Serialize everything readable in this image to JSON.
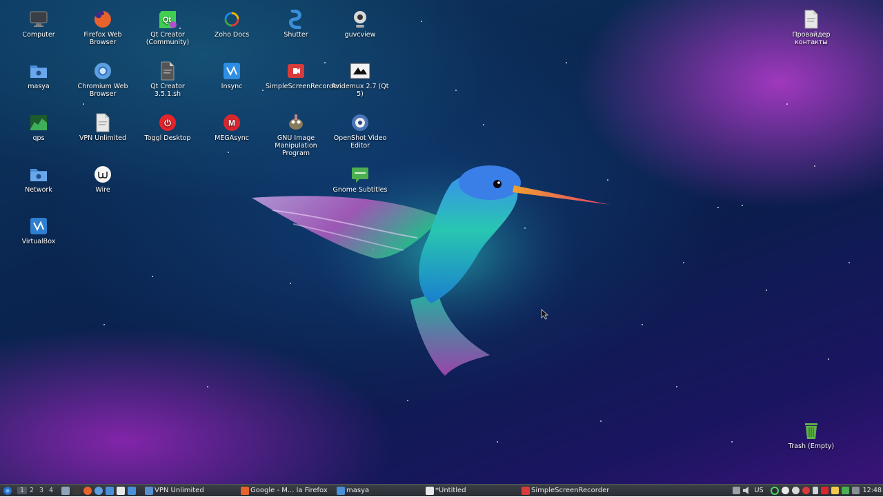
{
  "desktop": {
    "icons": [
      {
        "label": "Computer",
        "icon": "computer-icon",
        "color": "#3a3f46"
      },
      {
        "label": "Firefox Web Browser",
        "icon": "firefox-icon",
        "color": "#e8632b"
      },
      {
        "label": "Qt Creator (Community)",
        "icon": "qt-creator-icon",
        "color": "#41cd52"
      },
      {
        "label": "Zoho Docs",
        "icon": "zoho-docs-icon",
        "color": "#f4b400"
      },
      {
        "label": "Shutter",
        "icon": "shutter-icon",
        "color": "#3a8fd8"
      },
      {
        "label": "guvcview",
        "icon": "webcam-icon",
        "color": "#d9d9d9"
      },
      {
        "label": "Провайдер контакты",
        "icon": "document-icon",
        "color": "#e8e8e8"
      },
      {
        "label": "masya",
        "icon": "home-folder-icon",
        "color": "#4a8fd9"
      },
      {
        "label": "Chromium Web Browser",
        "icon": "chromium-icon",
        "color": "#5d9fe0"
      },
      {
        "label": "Qt Creator 3.5.1.sh",
        "icon": "script-file-icon",
        "color": "#555555"
      },
      {
        "label": "Insync",
        "icon": "insync-icon",
        "color": "#2f8de4"
      },
      {
        "label": "SimpleScreenRecorder",
        "icon": "screen-recorder-icon",
        "color": "#d83b3b"
      },
      {
        "label": "Avidemux 2.7 (Qt 5)",
        "icon": "avidemux-icon",
        "color": "#f2f2f2"
      },
      {
        "label": "qps",
        "icon": "qps-monitor-icon",
        "color": "#3fae5a"
      },
      {
        "label": "VPN Unlimited",
        "icon": "vpn-file-icon",
        "color": "#e8e8e8"
      },
      {
        "label": "Toggl Desktop",
        "icon": "toggl-icon",
        "color": "#e5232b"
      },
      {
        "label": "MEGAsync",
        "icon": "mega-icon",
        "color": "#d9272e"
      },
      {
        "label": "GNU Image Manipulation Program",
        "icon": "gimp-icon",
        "color": "#8a7a5c"
      },
      {
        "label": "OpenShot Video Editor",
        "icon": "openshot-icon",
        "color": "#4a74b8"
      },
      {
        "label": "Network",
        "icon": "network-folder-icon",
        "color": "#4a8fd9"
      },
      {
        "label": "Wire",
        "icon": "wire-icon",
        "color": "#f5f5f5"
      },
      {
        "label": "Gnome Subtitles",
        "icon": "subtitles-icon",
        "color": "#4caf50"
      },
      {
        "label": "VirtualBox",
        "icon": "virtualbox-icon",
        "color": "#2f7fd1"
      },
      {
        "label": "Trash (Empty)",
        "icon": "trash-icon",
        "color": "#5fb24a"
      }
    ]
  },
  "taskbar": {
    "workspaces": [
      "1",
      "2",
      "3",
      "4"
    ],
    "launchers": [
      "show-desktop-icon",
      "terminal-icon",
      "firefox-icon",
      "chromium-icon",
      "file-manager-icon",
      "text-editor-icon",
      "folder-icon"
    ],
    "tasks": [
      {
        "label": "VPN Unlimited",
        "icon": "vpn-icon",
        "color": "#5a8fd0"
      },
      {
        "label": "Google - M... la Firefox",
        "icon": "firefox-icon",
        "color": "#e8632b"
      },
      {
        "label": "masya",
        "icon": "folder-icon",
        "color": "#4a8fd9"
      },
      {
        "label": "*Untitled",
        "icon": "text-editor-icon",
        "color": "#e8e8e8"
      },
      {
        "label": "SimpleScreenRecorder",
        "icon": "screen-recorder-icon",
        "color": "#d83b3b"
      }
    ],
    "tray": {
      "keyboard_layout": "US",
      "clock": "12:48"
    }
  }
}
